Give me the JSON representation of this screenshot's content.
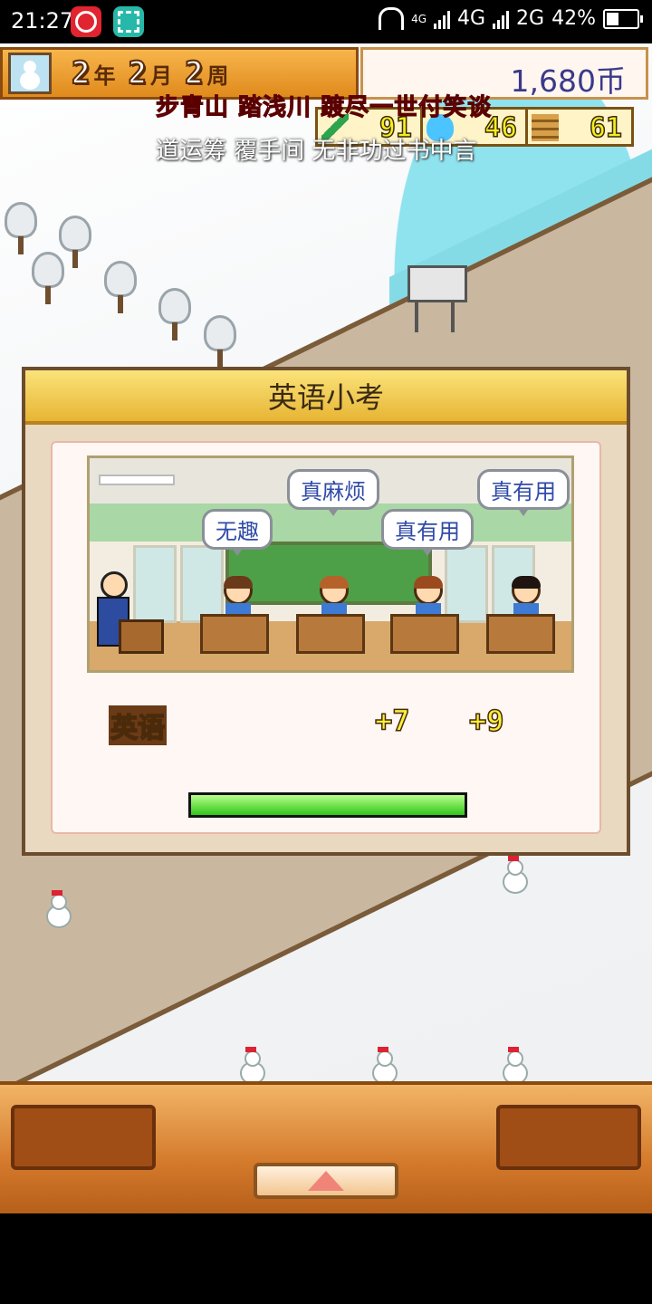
{
  "status_bar": {
    "time": "21:27",
    "network_small": "4G",
    "signal1": "4G",
    "signal2": "2G",
    "battery": "42%"
  },
  "hud": {
    "year_num": "2",
    "year_unit": "年",
    "month_num": "2",
    "month_unit": "月",
    "week_num": "2",
    "week_unit": "周",
    "money": "1,680币",
    "stat_study": "91",
    "stat_research": "46",
    "stat_building": "61",
    "icons": [
      "snowman-icon",
      "pencil-icon",
      "flask-icon",
      "building-icon"
    ]
  },
  "overlay_lyrics": {
    "line1": "步青山 踏浅川 踱尽一世付笑谈",
    "line2": "道运筹 覆手间 无非功过书中言"
  },
  "dialog": {
    "title": "英语小考",
    "bubbles": [
      "无趣",
      "真麻烦",
      "真有用",
      "真有用"
    ],
    "subject": "英语",
    "gain1": "+7",
    "gain2": "+9",
    "progress": 1.0
  },
  "colors": {
    "accent": "#e08a1c",
    "progress": "#32c51a",
    "lyric_red": "#e6322f"
  }
}
